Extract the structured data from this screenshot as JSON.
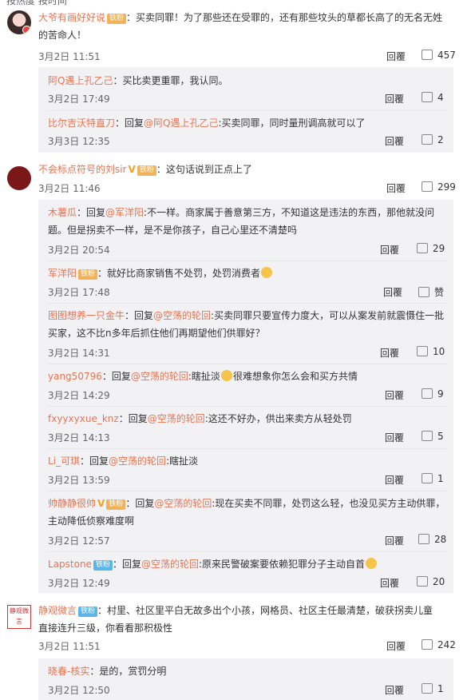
{
  "comments": [
    {
      "user": "大爷有画好好说",
      "badge": "铁粉",
      "text_line1": "：买卖同罪！为了那些还在受罪的，还有那些坟头的草都长高了的无名无姓",
      "text_line2": "的苦命人！",
      "time": "3月2日 11:51",
      "reply_label": "回覆",
      "likes": "457",
      "replies": [
        {
          "user": "阿Q遇上孔乙己",
          "text": "：买比卖更重罪，我认同。",
          "time": "3月2日 17:49",
          "reply_label": "回覆",
          "likes": "4"
        },
        {
          "user": "比尔吉沃特直刀",
          "text_a": "：回复",
          "mention": "@阿Q遇上孔乙己",
          "text_b": ":买卖同罪，同时量刑调高就可以了",
          "time": "3月3日 12:35",
          "reply_label": "回覆",
          "likes": "2"
        }
      ]
    },
    {
      "user": "不会标点符号的刘sir",
      "badge": "铁粉",
      "text_line1": "：这句话说到正点上了",
      "time": "3月2日 11:46",
      "reply_label": "回覆",
      "likes": "299",
      "replies": [
        {
          "user": "木薯瓜",
          "text_a": "：回复",
          "mention": "@军洋阳",
          "text_b": ":不一样。商家属于善意第三方，不知道这是违法的东西，那他就没问",
          "text_line2": "题。但是拐卖不一样，是不是你孩子，自己心里还不清楚吗",
          "time": "3月2日 20:54",
          "reply_label": "回覆",
          "likes": "29"
        },
        {
          "user": "军洋阳",
          "text": "：就好比商家销售不处罚，处罚消费者",
          "time": "3月2日 17:48",
          "reply_label": "回覆",
          "likes": "赞"
        },
        {
          "user": "图图想养一只金牛",
          "text_a": "：回复",
          "mention": "@空荡的轮回",
          "text_b": ":买卖同罪只要宣传力度大，可以从案发前就震慑住一批",
          "text_line2": "买家，这不比n多年后抓住他们再期望他们供罪好？",
          "time": "3月2日 14:31",
          "reply_label": "回覆",
          "likes": "10"
        },
        {
          "user": "yang50796",
          "text_a": "：回复",
          "mention": "@空荡的轮回",
          "text_b": ":瞎扯淡",
          "text_c": "很难想象你怎么会和买方共情",
          "time": "3月2日 14:29",
          "reply_label": "回覆",
          "likes": "9"
        },
        {
          "user": "fxyyxyxue_knz",
          "text_a": "：回复",
          "mention": "@空荡的轮回",
          "text_b": ":这还不好办，供出来卖方从轻处罚",
          "time": "3月2日 14:13",
          "reply_label": "回覆",
          "likes": "5"
        },
        {
          "user": "Li_可琪",
          "text_a": "：回复",
          "mention": "@空荡的轮回",
          "text_b": ":瞎扯淡",
          "time": "3月2日 13:59",
          "reply_label": "回覆",
          "likes": "1"
        },
        {
          "user": "帅静静很帅",
          "text_a": "：回复",
          "mention": "@空荡的轮回",
          "text_b": ":现在买卖不同罪，处罚这么轻，也没见买方主动供罪，",
          "text_line2": "主动降低侦察难度啊",
          "time": "3月2日 12:57",
          "reply_label": "回覆",
          "likes": "28"
        },
        {
          "user": "Lapstone",
          "badge": "铁粉",
          "text_a": "：回复",
          "mention": "@空荡的轮回",
          "text_b": ":原来民警破案要依赖犯罪分子主动自首",
          "time": "3月2日 12:49",
          "reply_label": "回覆",
          "likes": "20"
        }
      ]
    },
    {
      "user": "静观微言",
      "badge": "铁粉",
      "text_line1": "：村里、社区里平白无故多出个小孩，网格员、社区主任最清楚，破获拐卖儿童",
      "text_line2": "直接连升三级，你看看那积极性",
      "time": "3月2日 11:51",
      "reply_label": "回覆",
      "likes": "242",
      "replies": [
        {
          "user": "晓春-核实",
          "text": "：是的，赏罚分明",
          "time": "3月2日 12:50",
          "reply_label": "回覆",
          "likes": "1"
        }
      ]
    }
  ],
  "avatar3_text": "静观微言",
  "top_fragment": "按热度   按时间"
}
